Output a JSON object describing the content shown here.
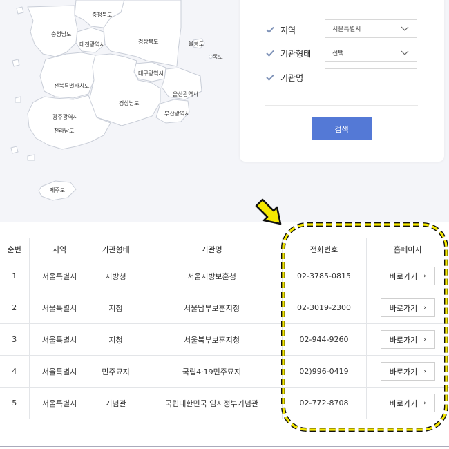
{
  "map": {
    "regions": [
      "충청북도",
      "충청남도",
      "대전광역시",
      "경상북도",
      "울릉도",
      "독도",
      "대구광역시",
      "전북특별자치도",
      "경상남도",
      "울산광역시",
      "부산광역시",
      "광주광역시",
      "전라남도",
      "제주도"
    ]
  },
  "search": {
    "region_label": "지역",
    "region_value": "서울특별시",
    "type_label": "기관형태",
    "type_value": "선택",
    "name_label": "기관명",
    "name_value": "",
    "button_label": "검색"
  },
  "table": {
    "headers": [
      "순번",
      "지역",
      "기관형태",
      "기관명",
      "전화번호",
      "홈페이지"
    ],
    "rows": [
      {
        "no": "1",
        "region": "서울특별시",
        "type": "지방청",
        "name": "서울지방보훈청",
        "phone": "02-3785-0815",
        "link": "바로가기"
      },
      {
        "no": "2",
        "region": "서울특별시",
        "type": "지청",
        "name": "서울남부보훈지청",
        "phone": "02-3019-2300",
        "link": "바로가기"
      },
      {
        "no": "3",
        "region": "서울특별시",
        "type": "지청",
        "name": "서울북부보훈지청",
        "phone": "02-944-9260",
        "link": "바로가기"
      },
      {
        "no": "4",
        "region": "서울특별시",
        "type": "민주묘지",
        "name": "국립4·19민주묘지",
        "phone": "02)996-0419",
        "link": "바로가기"
      },
      {
        "no": "5",
        "region": "서울특별시",
        "type": "기념관",
        "name": "국립대한민국 임시정부기념관",
        "phone": "02-772-8708",
        "link": "바로가기"
      }
    ]
  },
  "colors": {
    "accent": "#5479d6",
    "highlight": "#f5e800"
  },
  "icons": {
    "check": "check-icon",
    "dropdown": "chevron-down-icon",
    "link": "chevron-right-icon",
    "arrow": "pointer-arrow-icon"
  }
}
